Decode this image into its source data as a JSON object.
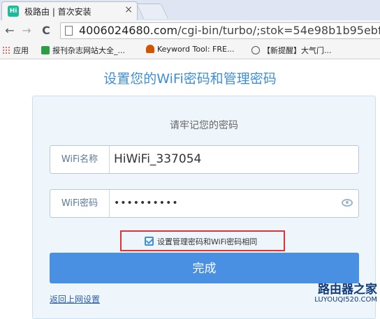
{
  "browser": {
    "tab": {
      "favicon": "hiwifi-logo",
      "title": "极路由 | 首次安装",
      "close": "×"
    },
    "nav": {
      "back": "←",
      "forward": "→",
      "reload": "C"
    },
    "address": {
      "host": "4006024680.com",
      "path": "/cgi-bin/turbo/;stok=54e98b1b95ebf("
    },
    "bookmarks": [
      {
        "icon": "apps-icon",
        "label": "应用"
      },
      {
        "icon": "bookmark-green-icon",
        "label": "报刊杂志网站大全_..."
      },
      {
        "icon": "bookmark-flame-icon",
        "label": "Keyword Tool: FRE..."
      },
      {
        "icon": "wordpress-icon",
        "label": "【新提醒】大气门..."
      }
    ]
  },
  "page": {
    "heading": "设置您的WiFi密码和管理密码",
    "subtitle": "请牢记您的密码",
    "ssid": {
      "label": "WiFi名称",
      "value": "HiWiFi_337054"
    },
    "password": {
      "label": "WiFi密码",
      "value": "••••••••••"
    },
    "same_password": {
      "checked": true,
      "label": "设置管理密码和WiFi密码相同"
    },
    "finish_button": "完成",
    "back_link": "返回上网设置"
  },
  "watermark": {
    "main": "路由器之家",
    "sub": "LUYOUQI520.COM"
  },
  "colors": {
    "accent": "#4a90e2",
    "highlight_border": "#d9343a",
    "heading": "#3c8fd8"
  }
}
